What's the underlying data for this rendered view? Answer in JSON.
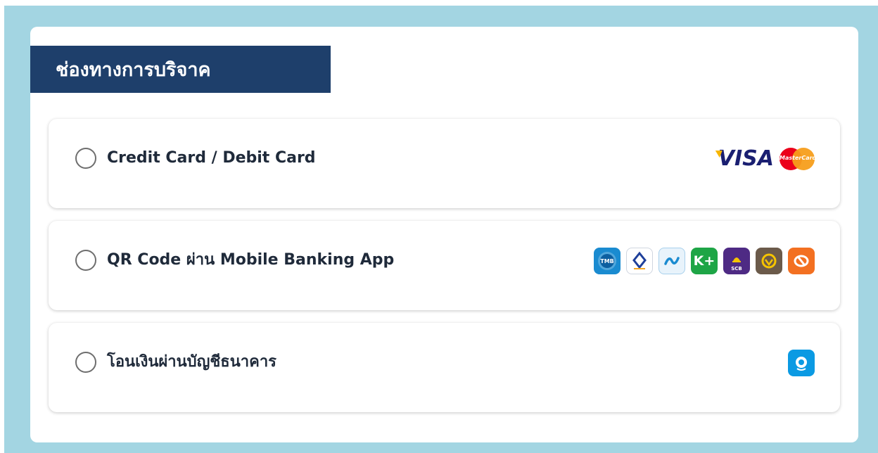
{
  "header": {
    "title": "ช่องทางการบริจาค"
  },
  "options": [
    {
      "label": "Credit Card / Debit Card",
      "logos": {
        "visa": "VISA",
        "mastercard": "MasterCard"
      }
    },
    {
      "label": "QR Code ผ่าน Mobile Banking App",
      "banks": [
        {
          "icon": "tmb-touch-icon",
          "text": "TMB"
        },
        {
          "icon": "bangkok-bank-icon"
        },
        {
          "icon": "krungthai-next-icon"
        },
        {
          "icon": "kplus-icon",
          "text": "K+"
        },
        {
          "icon": "scb-easy-icon",
          "text": "SCB"
        },
        {
          "icon": "krungsri-icon"
        },
        {
          "icon": "thanachart-icon"
        }
      ]
    },
    {
      "label": "โอนเงินผ่านบัญชีธนาคาร",
      "banks": [
        {
          "icon": "krungthai-bank-icon"
        }
      ]
    }
  ],
  "colors": {
    "page_background": "#a3d5e2",
    "header_background": "#1e3f6b",
    "label_text": "#1f2a3a"
  }
}
